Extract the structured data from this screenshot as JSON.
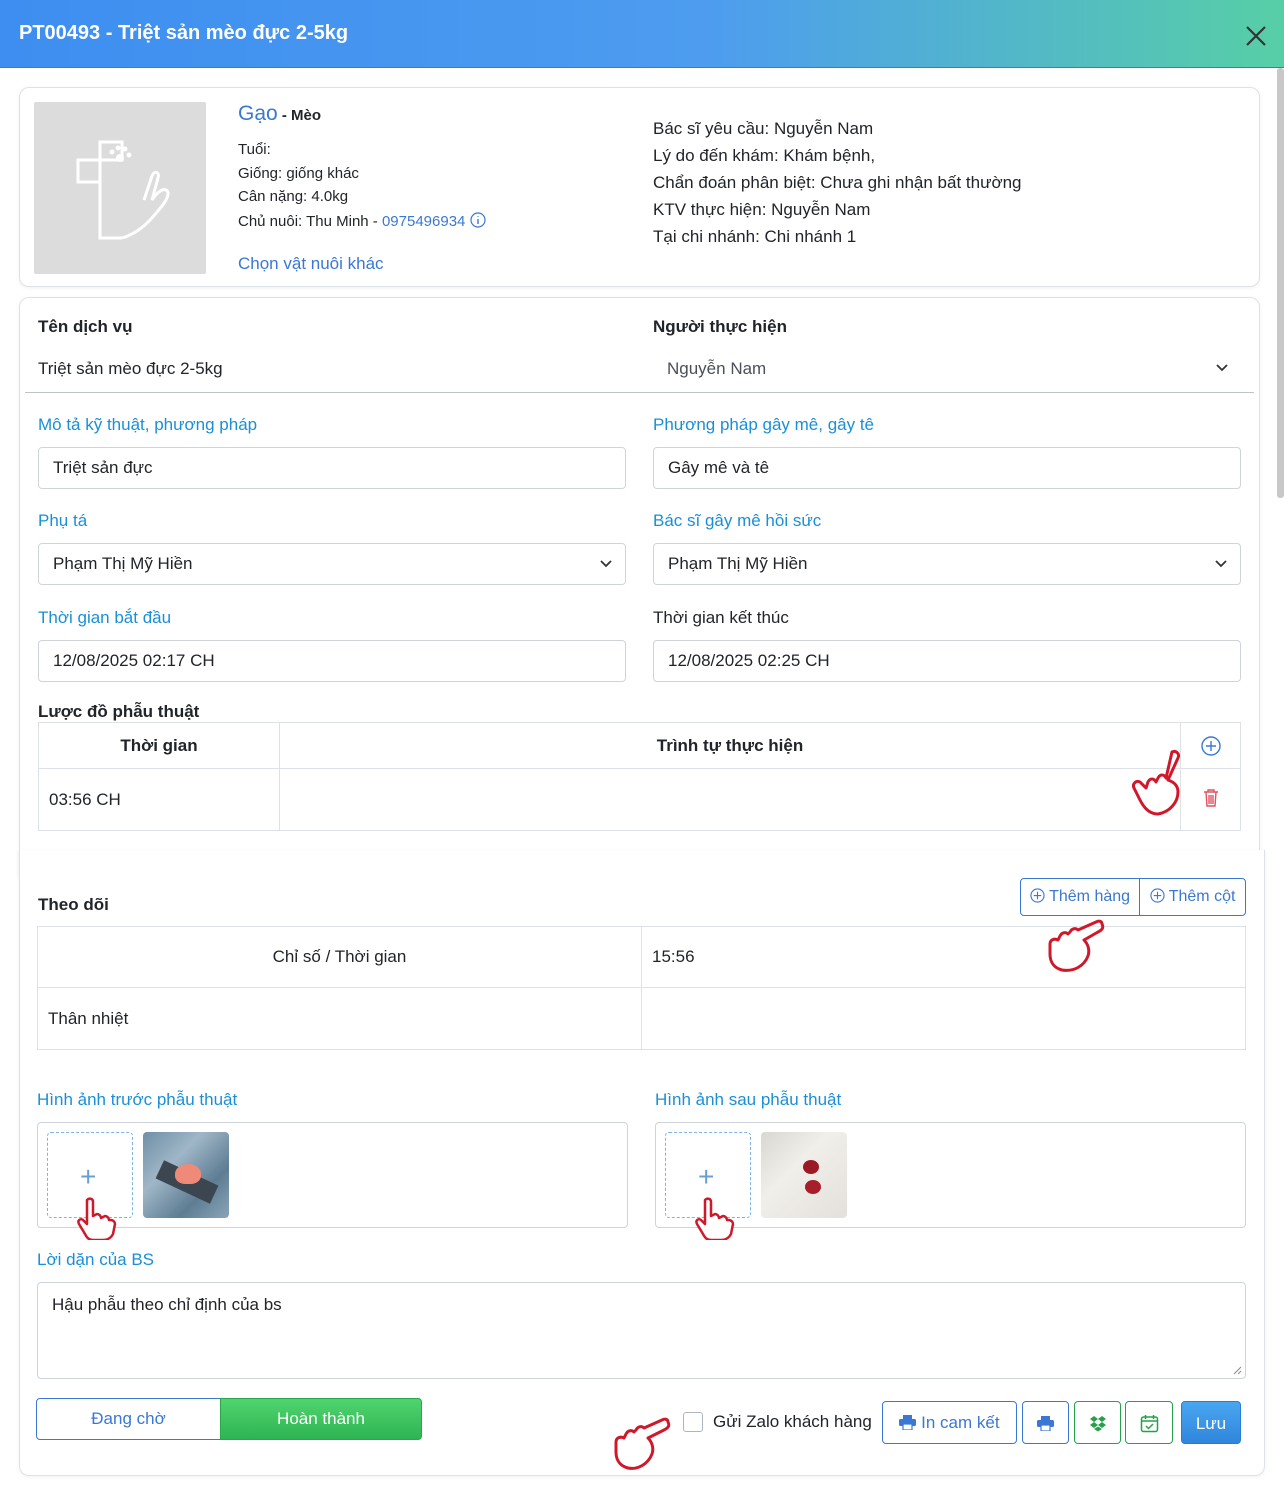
{
  "header": {
    "title": "PT00493 - Triệt sản mèo đực 2-5kg"
  },
  "pet": {
    "name": "Gạo",
    "species": " - Mèo",
    "age_label": "Tuổi:",
    "breed": "Giống: giống khác",
    "weight": "Cân nặng: 4.0kg",
    "owner_label": "Chủ nuôi: Thu Minh - ",
    "owner_phone": "0975496934",
    "choose_other": "Chọn vật nuôi khác"
  },
  "exam": {
    "doctor": "Bác sĩ yêu cầu: Nguyễn Nam",
    "reason": "Lý do đến khám: Khám bệnh,",
    "diagnosis": "Chẩn đoán phân biệt: Chưa ghi nhận bất thường",
    "technician": "KTV thực hiện: Nguyễn Nam",
    "branch": "Tại chi nhánh: Chi nhánh 1"
  },
  "service": {
    "name_label": "Tên dịch vụ",
    "name_value": "Triệt sản mèo đực 2-5kg",
    "performer_label": "Người thực hiện",
    "performer_value": "Nguyễn Nam",
    "technique_label": "Mô tả kỹ thuật, phương pháp",
    "technique_value": "Triệt sản đực",
    "anesthesia_label": "Phương pháp gây mê, gây tê",
    "anesthesia_value": "Gây mê và tê",
    "assistant_label": "Phụ tá",
    "assistant_value": "Phạm Thị Mỹ Hiền",
    "anesth_doctor_label": "Bác sĩ gây mê hồi sức",
    "anesth_doctor_value": "Phạm Thị Mỹ Hiền",
    "start_label": "Thời gian bắt đầu",
    "start_value": "12/08/2025 02:17  CH",
    "end_label": "Thời gian kết thúc",
    "end_value": "12/08/2025 02:25  CH"
  },
  "surgery_chart": {
    "title": "Lược đồ phẫu thuật",
    "col_time": "Thời gian",
    "col_steps": "Trình tự thực hiện",
    "rows": [
      {
        "time": "03:56  CH",
        "steps": ""
      }
    ]
  },
  "monitoring": {
    "title": "Theo dõi",
    "add_row": "Thêm hàng",
    "add_col": "Thêm cột",
    "header_left": "Chỉ số / Thời gian",
    "header_time": "15:56",
    "row1_label": "Thân nhiệt",
    "row1_value": ""
  },
  "images": {
    "before_label": "Hình ảnh trước phẫu thuật",
    "after_label": "Hình ảnh sau phẫu thuật"
  },
  "advice": {
    "label": "Lời dặn của BS",
    "value": "Hậu phẫu theo chỉ định của bs"
  },
  "footer": {
    "pending": "Đang chờ",
    "done": "Hoàn thành",
    "zalo": "Gửi Zalo khách hàng",
    "print_commit": "In cam kết",
    "save": "Lưu"
  },
  "colors": {
    "header_start": "#3d8ef0",
    "header_end": "#57cfa6",
    "label_blue": "#1a8fd8",
    "done_green": "#34c25a",
    "save_blue": "#3a8fe0",
    "hand_red": "#d0182b"
  }
}
